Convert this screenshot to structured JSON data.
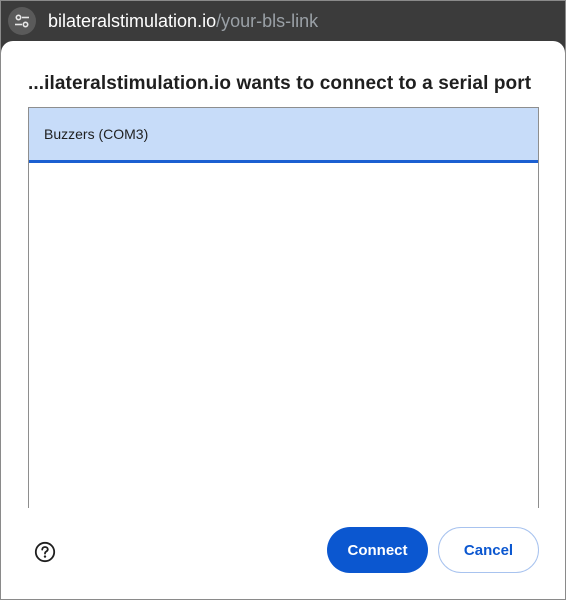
{
  "browser": {
    "url_domain": "bilateralstimulation.io",
    "url_path": "/your-bls-link",
    "site_info_icon": "tune-icon"
  },
  "dialog": {
    "title": "...ilateralstimulation.io wants to connect to a serial port",
    "devices": [
      {
        "label": "Buzzers (COM3)",
        "selected": true
      }
    ],
    "help_icon": "help-circle-icon",
    "connect_label": "Connect",
    "cancel_label": "Cancel"
  },
  "colors": {
    "primary": "#0b57d0",
    "selection": "#c7dcf9",
    "urlbar_bg": "#3b3b3b"
  }
}
